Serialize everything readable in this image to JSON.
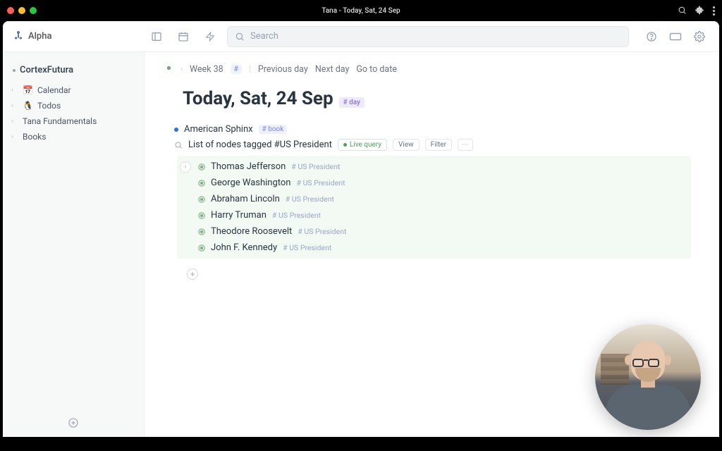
{
  "window": {
    "title": "Tana - Today, Sat, 24 Sep"
  },
  "workspace": {
    "name": "Alpha"
  },
  "search": {
    "placeholder": "Search"
  },
  "sidebar": {
    "workspace_root": "CortexFutura",
    "items": [
      {
        "emoji": "📅",
        "label": "Calendar"
      },
      {
        "emoji": "🐧",
        "label": "Todos"
      },
      {
        "emoji": "",
        "label": "Tana Fundamentals"
      },
      {
        "emoji": "",
        "label": "Books"
      }
    ]
  },
  "breadcrumb": {
    "week": "Week 38",
    "week_tag": "#",
    "prev": "Previous day",
    "next": "Next day",
    "goto": "Go to date"
  },
  "page": {
    "title": "Today, Sat, 24 Sep",
    "tag": "# day"
  },
  "nodes": {
    "book": {
      "title": "American Sphinx",
      "tag": "# book"
    },
    "query": {
      "title": "List of nodes tagged #US President",
      "live": "Live query",
      "view": "View",
      "filter": "Filter",
      "more": "⋯",
      "results": [
        {
          "name": "Thomas Jefferson",
          "tag": "# US President"
        },
        {
          "name": "George Washington",
          "tag": "# US President"
        },
        {
          "name": "Abraham Lincoln",
          "tag": "# US President"
        },
        {
          "name": "Harry Truman",
          "tag": "# US President"
        },
        {
          "name": "Theodore Roosevelt",
          "tag": "# US President"
        },
        {
          "name": "John F. Kennedy",
          "tag": "# US President"
        }
      ]
    }
  }
}
